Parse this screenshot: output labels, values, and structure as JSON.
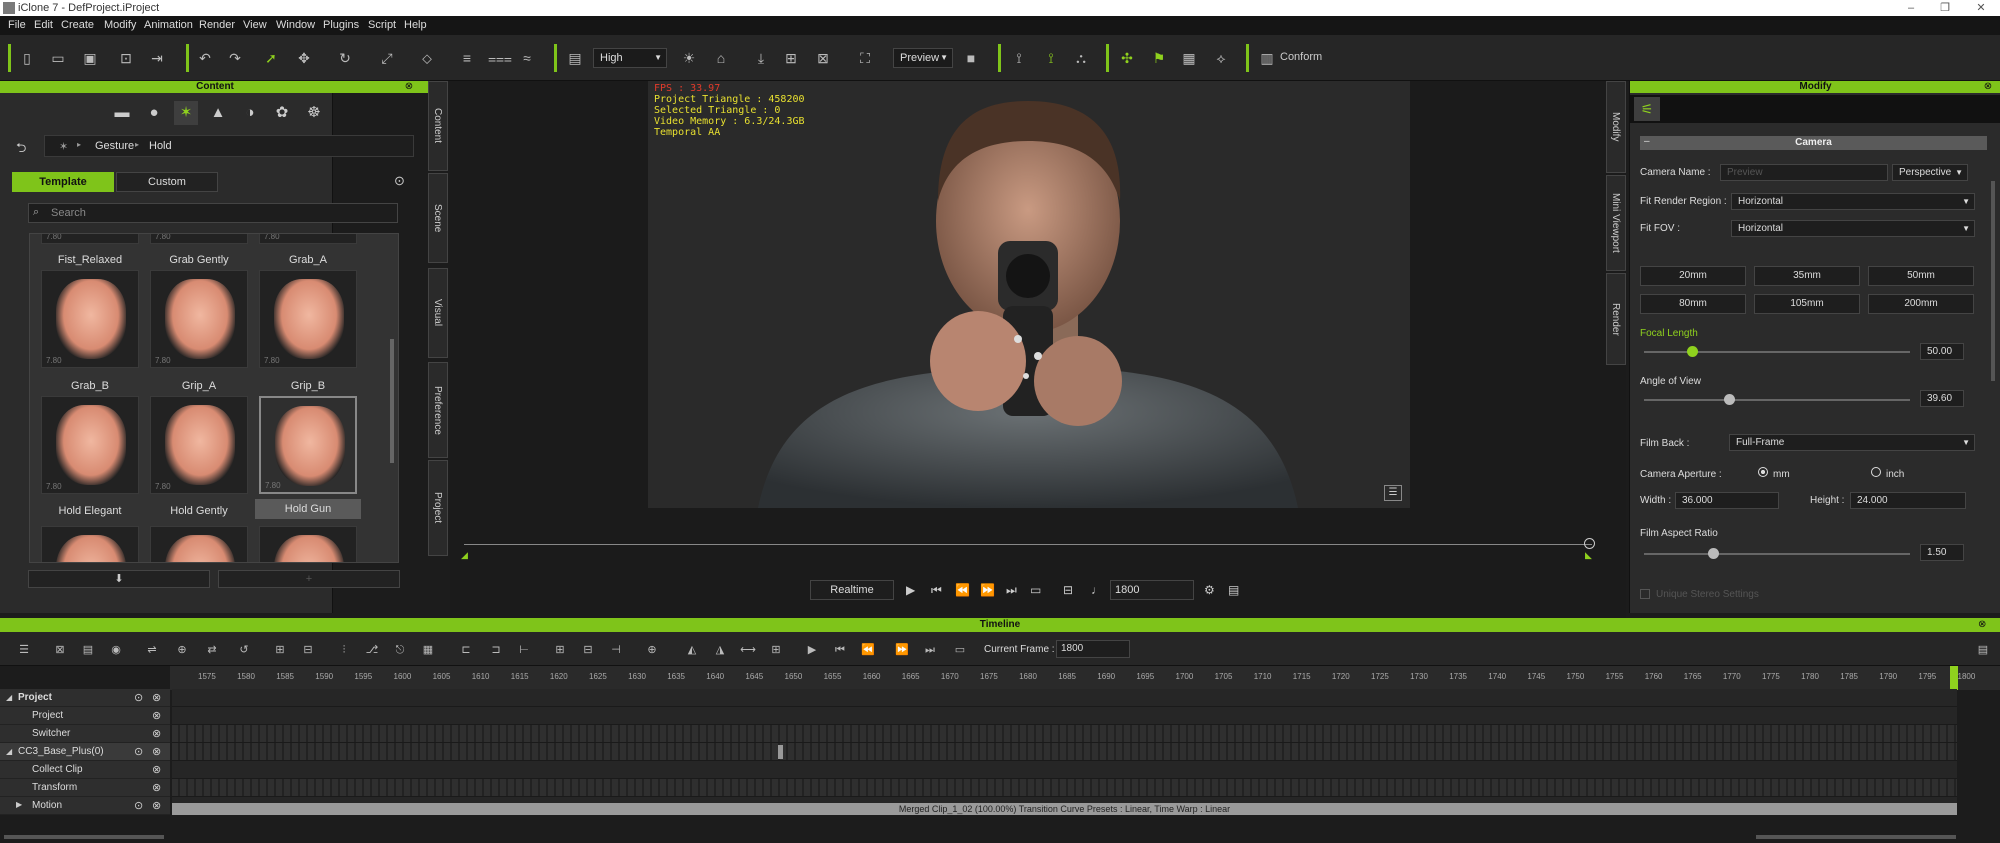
{
  "window": {
    "title": "iClone 7 - DefProject.iProject"
  },
  "menu": [
    "File",
    "Edit",
    "Create",
    "Modify",
    "Animation",
    "Render",
    "View",
    "Window",
    "Plugins",
    "Script",
    "Help"
  ],
  "toolbar": {
    "quality": "High",
    "render_mode": "Preview",
    "conform_label": "Conform"
  },
  "content": {
    "header": "Content",
    "breadcrumb": [
      "Gesture",
      "Hold"
    ],
    "tabs": [
      "Template",
      "Custom"
    ],
    "search_placeholder": "Search",
    "version": "7.80",
    "items": [
      {
        "label": "Fist_Relaxed"
      },
      {
        "label": "Grab Gently"
      },
      {
        "label": "Grab_A"
      },
      {
        "label": "Grab_B"
      },
      {
        "label": "Grip_A"
      },
      {
        "label": "Grip_B"
      },
      {
        "label": "Hold Elegant"
      },
      {
        "label": "Hold Gently"
      },
      {
        "label": "Hold Gun"
      }
    ],
    "side_tabs": [
      "Content",
      "Scene",
      "Visual",
      "Preference",
      "Project"
    ]
  },
  "viewport": {
    "fps": "FPS : 33.97",
    "project_triangle": "Project Triangle : 458200",
    "selected_triangle": "Selected Triangle : 0",
    "video_memory": "Video Memory : 6.3/24.3GB",
    "aa": "Temporal AA"
  },
  "playback": {
    "realtime": "Realtime",
    "frame": "1800"
  },
  "modify": {
    "header": "Modify",
    "section": "Camera",
    "side_tabs": [
      "Modify",
      "Mini Viewport",
      "Render"
    ],
    "camera_name_label": "Camera Name :",
    "camera_name_placeholder": "Preview",
    "projection": "Perspective",
    "fit_render_region_label": "Fit Render Region :",
    "fit_render_region": "Horizontal",
    "fit_fov_label": "Fit FOV :",
    "fit_fov": "Horizontal",
    "lens_buttons": [
      "20mm",
      "35mm",
      "50mm",
      "80mm",
      "105mm",
      "200mm"
    ],
    "focal_length_label": "Focal Length",
    "focal_length": "50.00",
    "focal_length_pct": 0.18,
    "angle_of_view_label": "Angle of View",
    "angle_of_view": "39.60",
    "angle_of_view_pct": 0.32,
    "film_back_label": "Film Back :",
    "film_back": "Full-Frame",
    "aperture_label": "Camera Aperture :",
    "aperture_mm": "mm",
    "aperture_inch": "inch",
    "width_label": "Width :",
    "width": "36.000",
    "height_label": "Height :",
    "height": "24.000",
    "film_aspect_label": "Film Aspect Ratio",
    "film_aspect": "1.50",
    "film_aspect_pct": 0.26,
    "stereo_label": "Unique Stereo Settings"
  },
  "timeline": {
    "header": "Timeline",
    "current_frame_label": "Current Frame :",
    "current_frame": "1800",
    "ticks": [
      "1575",
      "1580",
      "1585",
      "1590",
      "1595",
      "1600",
      "1605",
      "1610",
      "1615",
      "1620",
      "1625",
      "1630",
      "1635",
      "1640",
      "1645",
      "1650",
      "1655",
      "1660",
      "1665",
      "1670",
      "1675",
      "1680",
      "1685",
      "1690",
      "1695",
      "1700",
      "1705",
      "1710",
      "1715",
      "1720",
      "1725",
      "1730",
      "1735",
      "1740",
      "1745",
      "1750",
      "1755",
      "1760",
      "1765",
      "1770",
      "1775",
      "1780",
      "1785",
      "1790",
      "1795",
      "1800"
    ],
    "tracks": [
      "Project",
      "Project",
      "Switcher",
      "CC3_Base_Plus(0)",
      "Collect Clip",
      "Transform",
      "Motion"
    ],
    "clip_label": "Merged Clip_1_02 (100.00%) Transition Curve Presets : Linear, Time Warp : Linear"
  }
}
